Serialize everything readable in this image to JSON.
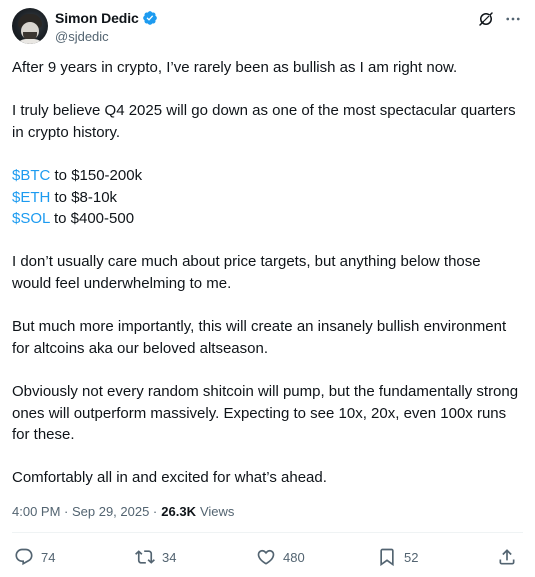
{
  "author": {
    "display_name": "Simon Dedic",
    "handle": "@sjdedic",
    "verified": true,
    "avatar_icon": "avatar-photo"
  },
  "header_icons": {
    "grok": "grok-icon",
    "more": "more-icon"
  },
  "tweet": {
    "p1": "After 9 years in crypto, I’ve rarely been as bullish as I am right now.",
    "p2": "I truly believe Q4 2025 will go down as one of the most spectacular quarters in crypto history.",
    "targets": [
      {
        "tag": "$BTC",
        "text": " to $150-200k"
      },
      {
        "tag": "$ETH",
        "text": " to $8-10k"
      },
      {
        "tag": "$SOL",
        "text": " to $400-500"
      }
    ],
    "p4": "I don’t usually care much about price targets, but anything below those would feel underwhelming to me.",
    "p5": "But much more importantly, this will create an insanely bullish environment for altcoins aka our beloved altseason.",
    "p6": "Obviously not every random shitcoin will pump, but the fundamentally strong ones will outperform massively. Expecting to see 10x, 20x, even 100x runs for these.",
    "p7": "Comfortably all in and excited for what’s ahead."
  },
  "meta": {
    "timestamp": "4:00 PM · Sep 29, 2025 · ",
    "views_count": "26.3K",
    "views_label": "Views"
  },
  "actions": {
    "replies": "74",
    "reposts": "34",
    "likes": "480",
    "bookmarks": "52"
  },
  "colors": {
    "text": "#0f1419",
    "secondary": "#536471",
    "accent": "#1d9bf0",
    "divider": "#eff3f4"
  }
}
